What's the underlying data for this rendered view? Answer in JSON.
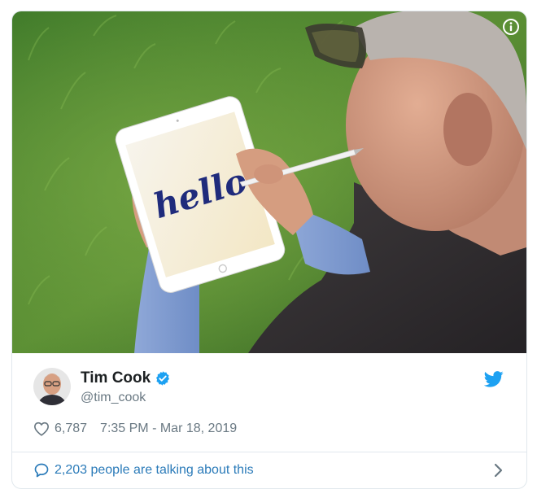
{
  "tweet": {
    "author": {
      "name": "Tim Cook",
      "handle": "@tim_cook",
      "verified": true
    },
    "media_caption": "hello",
    "likes": "6,787",
    "timestamp": "7:35 PM - Mar 18, 2019",
    "conversation_text": "2,203 people are talking about this"
  },
  "icons": {
    "info": "info-icon",
    "verified": "verified-badge-icon",
    "brand": "twitter-bird-icon",
    "like": "heart-icon",
    "reply": "speech-bubble-icon",
    "chevron": "chevron-right-icon"
  },
  "colors": {
    "brand_blue": "#1da1f2",
    "link_blue": "#2b7bb9",
    "muted_text": "#697882",
    "border": "#e1e8ed"
  }
}
